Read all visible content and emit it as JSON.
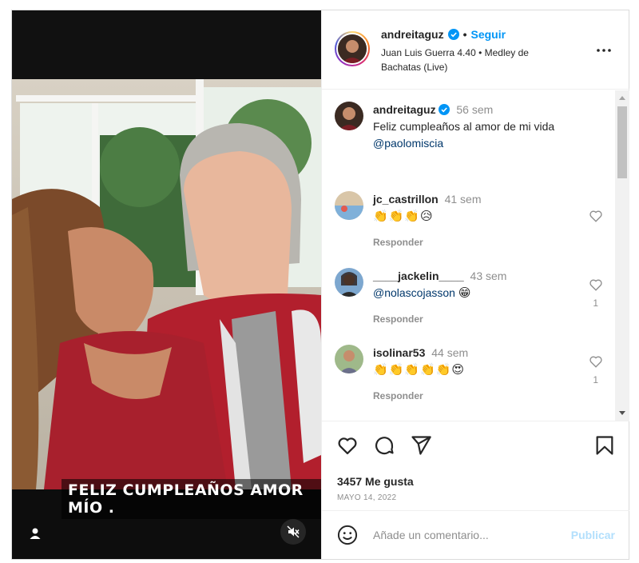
{
  "post": {
    "overlay_caption": "FELIZ CUMPLEAÑOS AMOR MÍO .",
    "icons": {
      "user_tag": "user-tag-icon",
      "mute": "muted-speaker-icon"
    }
  },
  "header": {
    "username": "andreitaguz",
    "separator": "•",
    "follow_label": "Seguir",
    "music": "Juan Luis Guerra 4.40 • Medley de Bachatas (Live)",
    "more_icon": "more-options-icon"
  },
  "caption": {
    "username": "andreitaguz",
    "time": "56 sem",
    "text": "Feliz cumpleaños al amor de mi vida",
    "mention": "@paolomiscia"
  },
  "comments": [
    {
      "username": "jc_castrillon",
      "time": "41 sem",
      "text": "👏👏👏😥",
      "reply": "Responder",
      "likes": ""
    },
    {
      "username": "____jackelin____",
      "time": "43 sem",
      "mention": "@nolascojasson",
      "text": "😁",
      "reply": "Responder",
      "likes": "1"
    },
    {
      "username": "isolinar53",
      "time": "44 sem",
      "text": "👏👏👏👏👏😍",
      "reply": "Responder",
      "likes": "1"
    }
  ],
  "actions": {
    "icons": [
      "heart-icon",
      "comment-icon",
      "share-icon",
      "bookmark-icon"
    ],
    "likes_text": "3457 Me gusta",
    "date": "MAYO 14, 2022"
  },
  "add_comment": {
    "placeholder": "Añade un comentario...",
    "publish_label": "Publicar"
  },
  "colors": {
    "accent": "#0095f6",
    "publish_disabled": "#b2dffc",
    "muted_text": "#8e8e8e"
  }
}
